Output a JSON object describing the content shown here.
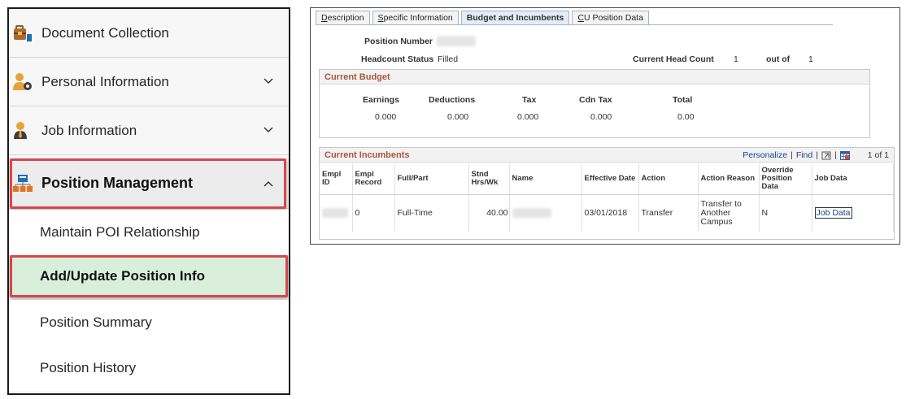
{
  "nav": {
    "items": [
      {
        "label": "Document Collection",
        "icon": "briefcase-icon"
      },
      {
        "label": "Personal Information",
        "icon": "person-gear-icon"
      },
      {
        "label": "Job Information",
        "icon": "person-tie-icon"
      },
      {
        "label": "Position Management",
        "icon": "org-chart-icon"
      }
    ],
    "subitems": [
      {
        "label": "Maintain POI Relationship"
      },
      {
        "label": "Add/Update Position Info"
      },
      {
        "label": "Position Summary"
      },
      {
        "label": "Position History"
      }
    ],
    "highlight_color": "#d7474b",
    "active_bg": "#d9efdc"
  },
  "tabs": [
    {
      "label": "Description",
      "accesskey": "D",
      "rest": "escription"
    },
    {
      "label": "Specific Information",
      "accesskey": "S",
      "rest": "pecific Information"
    },
    {
      "label": "Budget and Incumbents",
      "accesskey": "",
      "rest": "Budget and Incumbents"
    },
    {
      "label": "CU Position Data",
      "accesskey": "C",
      "rest": "U Position Data"
    }
  ],
  "header": {
    "position_number_label": "Position Number",
    "headcount_status_label": "Headcount Status",
    "headcount_status_value": "Filled",
    "current_head_count_label": "Current Head Count",
    "current_head_count_value": "1",
    "out_of_label": "out of",
    "out_of_value": "1"
  },
  "budget": {
    "title": "Current Budget",
    "columns": [
      "Earnings",
      "Deductions",
      "Tax",
      "Cdn Tax",
      "Total"
    ],
    "values": [
      "0.000",
      "0.000",
      "0.000",
      "0.000",
      "0.00"
    ]
  },
  "incumbents": {
    "title": "Current Incumbents",
    "personalize": "Personalize",
    "find": "Find",
    "pager": "1 of 1",
    "columns": [
      "Empl ID",
      "Empl Record",
      "Full/Part",
      "Stnd Hrs/Wk",
      "Name",
      "Effective Date",
      "Action",
      "Action Reason",
      "Override Position Data",
      "Job Data"
    ],
    "row": {
      "empl_record": "0",
      "full_part": "Full-Time",
      "stnd_hrs": "40.00",
      "effective_date": "03/01/2018",
      "action": "Transfer",
      "action_reason": "Transfer to Another Campus",
      "override": "N",
      "job_data": "Job Data"
    }
  }
}
